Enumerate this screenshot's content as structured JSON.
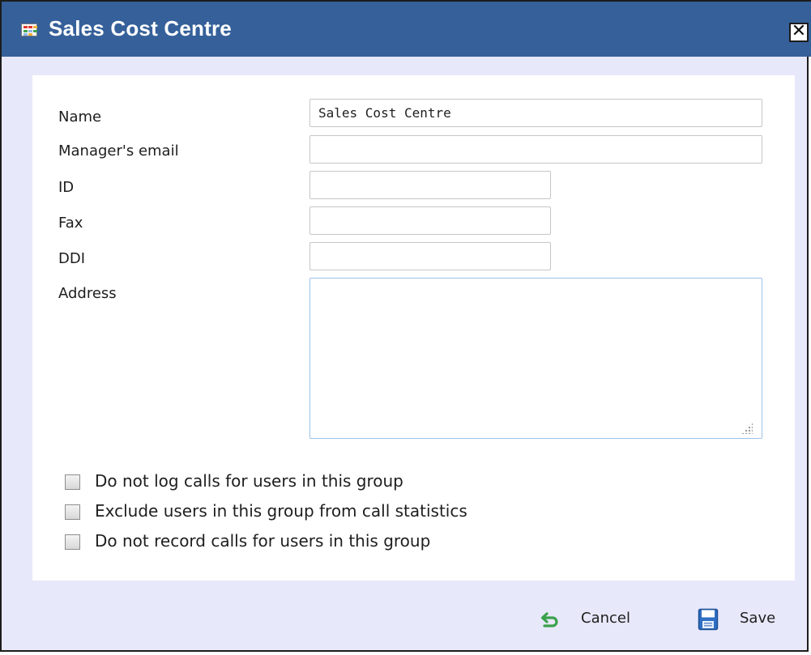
{
  "dialog": {
    "title": "Sales Cost Centre",
    "close_glyph": "✕"
  },
  "form": {
    "name": {
      "label": "Name",
      "value": "Sales Cost Centre"
    },
    "manager_email": {
      "label": "Manager's email",
      "value": ""
    },
    "id": {
      "label": "ID",
      "value": ""
    },
    "fax": {
      "label": "Fax",
      "value": ""
    },
    "ddi": {
      "label": "DDI",
      "value": ""
    },
    "address": {
      "label": "Address",
      "value": ""
    }
  },
  "options": [
    {
      "label": "Do not log calls for users in this group",
      "checked": false
    },
    {
      "label": "Exclude users in this group from call statistics",
      "checked": false
    },
    {
      "label": "Do not record calls for users in this group",
      "checked": false
    }
  ],
  "actions": {
    "cancel": {
      "label": "Cancel",
      "icon": "undo-arrow-icon"
    },
    "save": {
      "label": "Save",
      "icon": "floppy-disk-icon"
    }
  },
  "colors": {
    "titlebar": "#35609a",
    "dialog_background": "#e8e8fb",
    "panel": "#ffffff",
    "cancel_icon": "#3aa14a",
    "save_icon": "#2f6fc4"
  }
}
